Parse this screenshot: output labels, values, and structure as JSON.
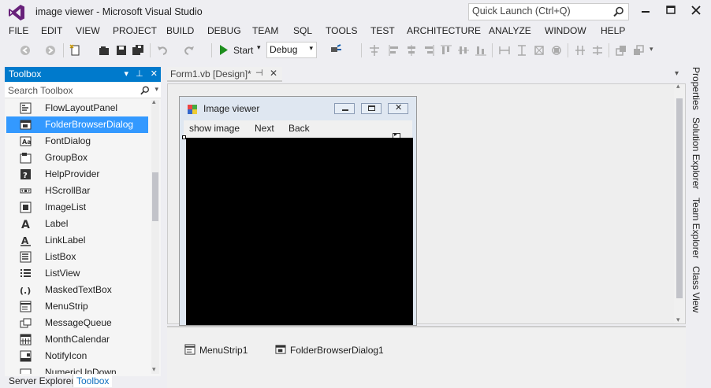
{
  "window": {
    "title": "image viewer - Microsoft Visual Studio",
    "quick_launch_placeholder": "Quick Launch (Ctrl+Q)"
  },
  "menu": [
    "FILE",
    "EDIT",
    "VIEW",
    "PROJECT",
    "BUILD",
    "DEBUG",
    "TEAM",
    "SQL",
    "TOOLS",
    "TEST",
    "ARCHITECTURE",
    "ANALYZE",
    "WINDOW",
    "HELP"
  ],
  "toolbar": {
    "start_label": "Start",
    "config_value": "Debug"
  },
  "toolbox": {
    "title": "Toolbox",
    "search_placeholder": "Search Toolbox",
    "items": [
      {
        "label": "FlowLayoutPanel",
        "icon": "flowlayout-icon"
      },
      {
        "label": "FolderBrowserDialog",
        "icon": "folderbrowser-icon"
      },
      {
        "label": "FontDialog",
        "icon": "fontdialog-icon"
      },
      {
        "label": "GroupBox",
        "icon": "groupbox-icon"
      },
      {
        "label": "HelpProvider",
        "icon": "helpprovider-icon"
      },
      {
        "label": "HScrollBar",
        "icon": "hscrollbar-icon"
      },
      {
        "label": "ImageList",
        "icon": "imagelist-icon"
      },
      {
        "label": "Label",
        "icon": "label-icon"
      },
      {
        "label": "LinkLabel",
        "icon": "linklabel-icon"
      },
      {
        "label": "ListBox",
        "icon": "listbox-icon"
      },
      {
        "label": "ListView",
        "icon": "listview-icon"
      },
      {
        "label": "MaskedTextBox",
        "icon": "maskedtextbox-icon"
      },
      {
        "label": "MenuStrip",
        "icon": "menustrip-icon"
      },
      {
        "label": "MessageQueue",
        "icon": "messagequeue-icon"
      },
      {
        "label": "MonthCalendar",
        "icon": "monthcalendar-icon"
      },
      {
        "label": "NotifyIcon",
        "icon": "notifyicon-icon"
      },
      {
        "label": "NumericUpDown",
        "icon": "numericupdown-icon"
      }
    ],
    "selected_index": 1
  },
  "bottom_tabs": {
    "server_explorer": "Server Explorer",
    "toolbox": "Toolbox"
  },
  "document": {
    "tab_label": "Form1.vb [Design]*"
  },
  "form": {
    "title": "Image viewer",
    "menu": [
      "show image",
      "Next",
      "Back"
    ]
  },
  "tray": {
    "items": [
      "MenuStrip1",
      "FolderBrowserDialog1"
    ]
  },
  "side_tabs": [
    "Properties",
    "Solution Explorer",
    "Team Explorer",
    "Class View"
  ],
  "colors": {
    "accent": "#007acc",
    "selection": "#3399ff",
    "start_icon": "#1f8f1f"
  }
}
